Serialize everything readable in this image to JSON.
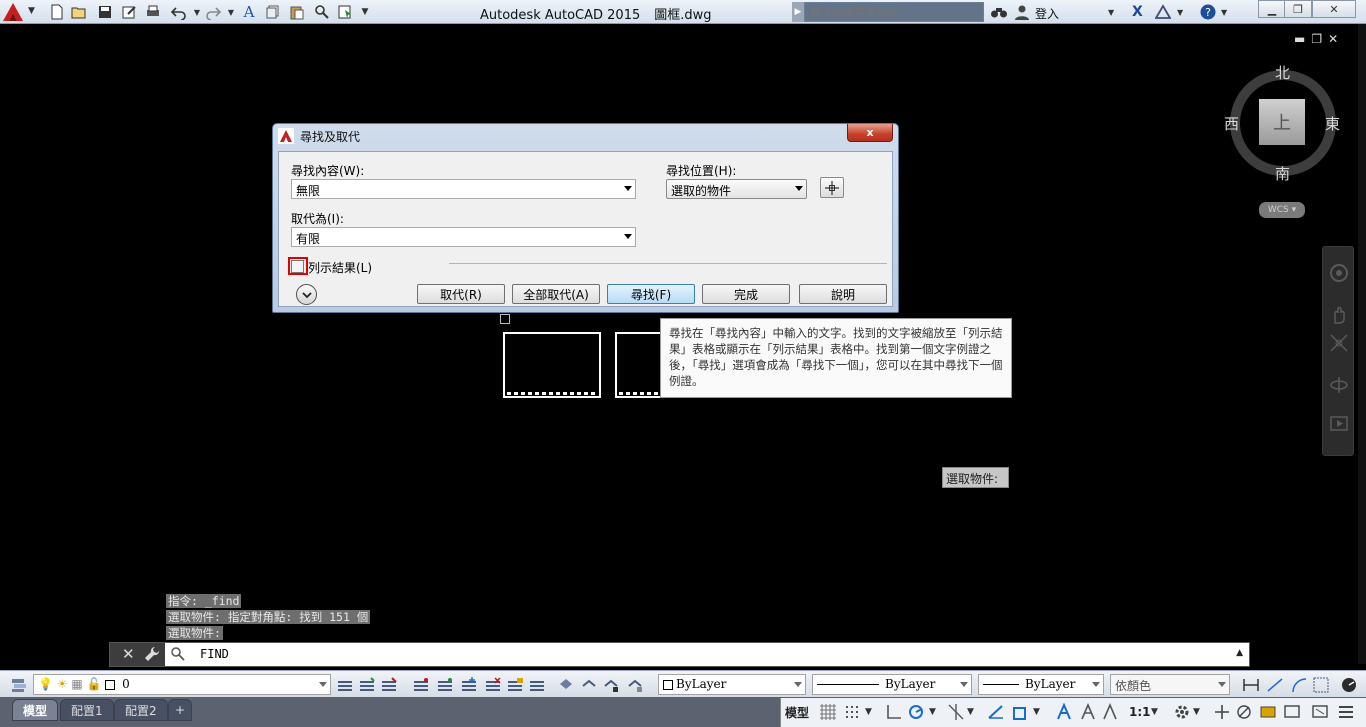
{
  "window": {
    "app_title": "Autodesk AutoCAD 2015",
    "file_name": "圖框.dwg",
    "search_placeholder": "鍵入關鍵字或詞組",
    "signin_label": "登入"
  },
  "viewcube": {
    "face": "上",
    "north": "北",
    "south": "南",
    "east": "東",
    "west": "西",
    "wcs": "WCS"
  },
  "dialog": {
    "title": "尋找及取代",
    "close_label": "x",
    "find_label": "尋找內容(W):",
    "find_value": "無限",
    "replace_label": "取代為(I):",
    "replace_value": "有限",
    "location_label": "尋找位置(H):",
    "location_value": "選取的物件",
    "list_results_label": "列示結果(L)",
    "buttons": {
      "replace": "取代(R)",
      "replace_all": "全部取代(A)",
      "find": "尋找(F)",
      "done": "完成",
      "help": "說明"
    }
  },
  "tooltip": {
    "text": "尋找在「尋找內容」中輸入的文字。找到的文字被縮放至「列示結果」表格或顯示在「列示結果」表格中。找到第一個文字例證之後，「尋找」選項會成為「尋找下一個」，您可以在其中尋找下一個例證。"
  },
  "prompt": {
    "select_objects": "選取物件:"
  },
  "command_history": [
    "指令: _find",
    "選取物件: 指定對角點: 找到 151 個",
    "選取物件:"
  ],
  "command_line": {
    "input": "FIND"
  },
  "properties_bar": {
    "layer": "0",
    "color": "ByLayer",
    "linetype": "ByLayer",
    "lineweight": "ByLayer",
    "plot_style": "依顏色"
  },
  "status": {
    "tabs": [
      "模型",
      "配置1",
      "配置2"
    ],
    "add_tab": "+",
    "model_label": "模型",
    "scale": "1:1"
  }
}
